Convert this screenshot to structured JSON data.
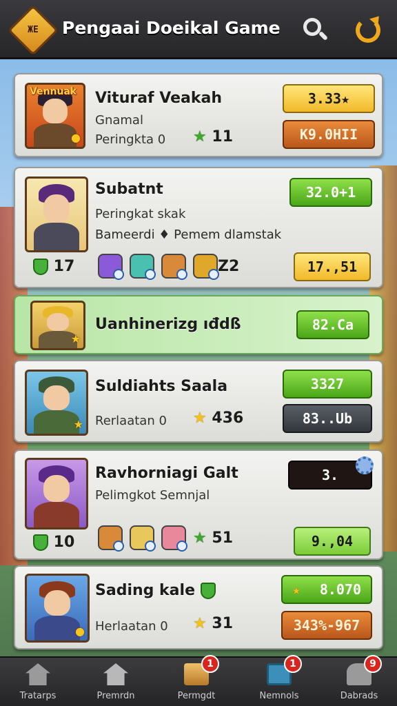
{
  "app": {
    "logo_text": "ЖЕ",
    "title": "Pengaai Doeikal Game"
  },
  "colors": {
    "header_bg": "#2e2e31",
    "accent_orange": "#f0a91c",
    "highlight_row": "#c6ecb6"
  },
  "players": [
    {
      "avatar_tag": "Vennuak",
      "name": "Vituraf Veakah",
      "subtitle": "Gnamal",
      "rank_label": "Peringkta 0",
      "stat_value": "11",
      "pill_top": "3.33★",
      "pill_bottom": "K9.0HII"
    },
    {
      "name": "Subatnt",
      "subtitle": "Peringkat skak",
      "description": "Bameerdi ♦ Pemem dlamstak",
      "shield_value": "17",
      "item_count": "Z2",
      "pill_top": "32.0+1",
      "pill_bottom": "17.,51"
    },
    {
      "name": "Uanhinerizg ıđdß",
      "pill_top": "82.Ca"
    },
    {
      "name": "Suldiahts Saala",
      "rank_label": "Rerlaatan 0",
      "stat_value": "436",
      "pill_top": "3327",
      "pill_bottom": "83..Ub"
    },
    {
      "name": "Ravhorniagi Galt",
      "subtitle": "Pelimgkot  Semnjal",
      "shield_value": "10",
      "stat_value": "51",
      "pill_top": "3.",
      "pill_bottom": "9.,04"
    },
    {
      "name": "Sading kale",
      "rank_label": "Herlaatan 0",
      "stat_value": "31",
      "pill_top": "8.070",
      "pill_bottom": "343%-967"
    }
  ],
  "nav": [
    {
      "label": "Tratarps",
      "icon": "home-icon",
      "badge": ""
    },
    {
      "label": "Premrdn",
      "icon": "house-icon",
      "badge": ""
    },
    {
      "label": "Permgdt",
      "icon": "scroll-icon",
      "badge": "1"
    },
    {
      "label": "Nemnols",
      "icon": "checkbox-icon",
      "badge": "1"
    },
    {
      "label": "Dabrads",
      "icon": "people-icon",
      "badge": "9"
    }
  ]
}
